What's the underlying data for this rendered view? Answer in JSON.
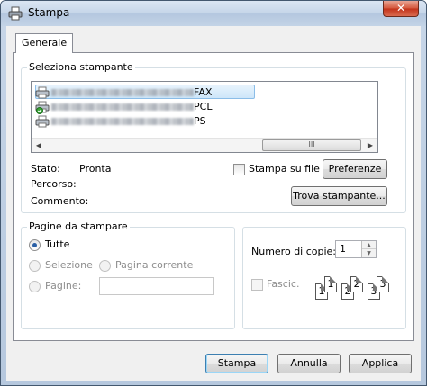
{
  "window": {
    "title": "Stampa",
    "close_glyph": "✕"
  },
  "tabs": [
    {
      "label": "Generale"
    }
  ],
  "printer_group": {
    "label": "Seleziona stampante",
    "printers": [
      {
        "suffix": "FAX",
        "icon": "printer-fax-icon",
        "selected": true
      },
      {
        "suffix": "PCL",
        "icon": "printer-default-icon",
        "selected": false
      },
      {
        "suffix": "PS",
        "icon": "printer-icon",
        "selected": false
      }
    ],
    "scrollbar_thumb_glyph": "III",
    "status_label": "Stato:",
    "status_value": "Pronta",
    "location_label": "Percorso:",
    "comment_label": "Commento:",
    "print_to_file_label": "Stampa su file",
    "preferences_label": "Preferenze",
    "find_printer_label": "Trova stampante..."
  },
  "page_range": {
    "label": "Pagine da stampare",
    "all_label": "Tutte",
    "selection_label": "Selezione",
    "current_page_label": "Pagina corrente",
    "pages_label": "Pagine:",
    "pages_value": ""
  },
  "copies": {
    "label": "Numero di copie:",
    "value": "1",
    "collate_label": "Fascic.",
    "collate_pages": [
      "1",
      "1",
      "2",
      "2",
      "3",
      "3"
    ]
  },
  "footer": {
    "print_label": "Stampa",
    "cancel_label": "Annulla",
    "apply_label": "Applica"
  }
}
